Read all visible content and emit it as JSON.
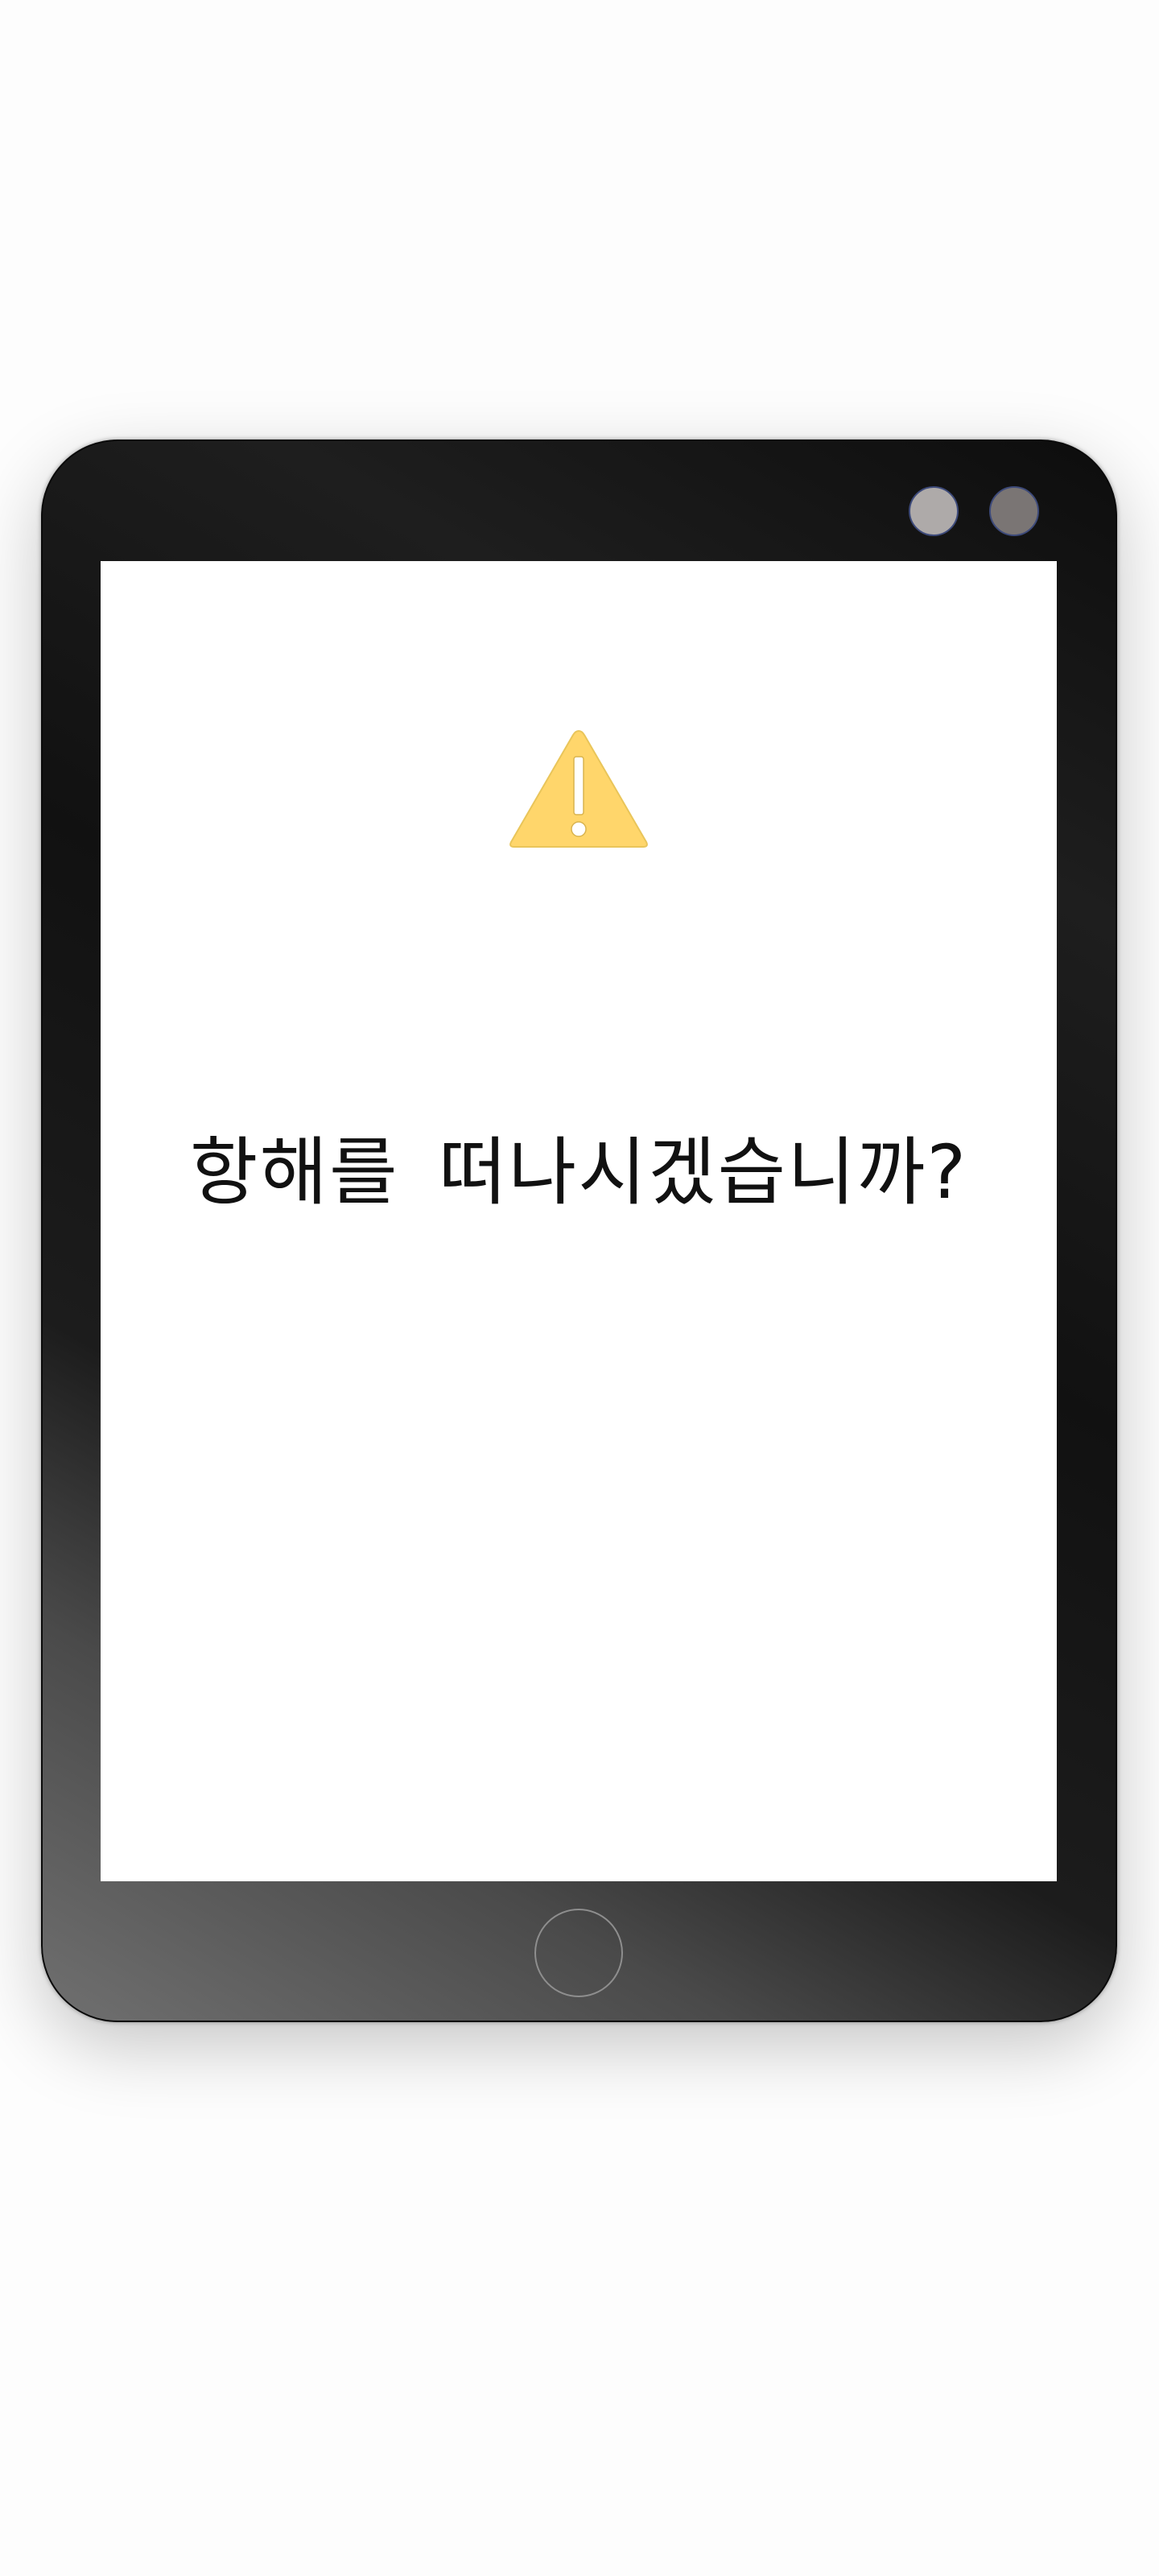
{
  "dialog": {
    "icon": "warning-icon",
    "message": "항해를 떠나시겠습니까?"
  },
  "device": {
    "cameras": [
      "camera",
      "camera"
    ],
    "home_button": "home-button"
  },
  "colors": {
    "warning": "#ffd66b",
    "frame": "#111111",
    "screen": "#ffffff"
  }
}
